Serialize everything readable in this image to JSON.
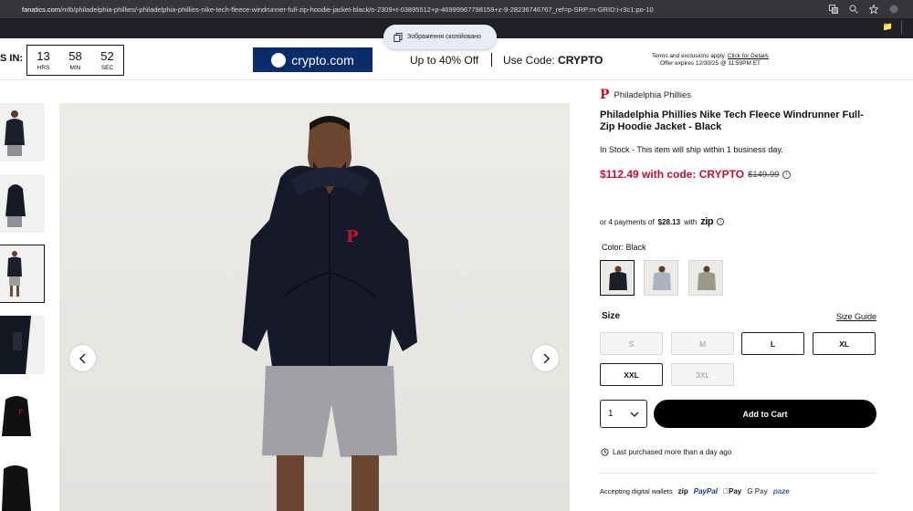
{
  "browser": {
    "url_host": "fanatics.com",
    "url_path": "/mlb/philadelphia-phillies/-philadelphia-phillies-nike-tech-fleece-windrunner-full-zip-hoodie-jacket-black/o-2309+t-03895512+p-46999967798159+z-9-28236746767_ref=p-SRP:m-GRID:i-r3c1:po-10",
    "icons": [
      "translate-icon",
      "zoom-icon",
      "star-icon",
      "profile-icon"
    ]
  },
  "promo": {
    "ends_label": "S IN:",
    "countdown": [
      {
        "value": "13",
        "label": "HRS"
      },
      {
        "value": "58",
        "label": "MIN"
      },
      {
        "value": "52",
        "label": "SEC"
      }
    ],
    "partner_name": "crypto.com",
    "offer": "Up to 40% Off",
    "code_prefix": "Use Code:",
    "code": "CRYPTO",
    "terms_line1": "Terms and exclusions apply.",
    "terms_link": "Click for Details",
    "terms_line2": "Offer expires 12/30/25 @ 11:59PM ET"
  },
  "toast": {
    "text": "Зображення скопійовано"
  },
  "gallery": {
    "prev_icon": "chevron-left-icon",
    "next_icon": "chevron-right-icon"
  },
  "product": {
    "team": "Philadelphia Phillies",
    "title": "Philadelphia Phillies Nike Tech Fleece Windrunner Full-Zip Hoodie Jacket - Black",
    "stock": "In Stock - This item will ship within 1 business day.",
    "price": "$112.49 with code: CRYPTO",
    "original_price": "$149.99",
    "installments_prefix": "or 4 payments of",
    "installments_amount": "$28.13",
    "installments_with": "with",
    "installments_provider": "zip",
    "color_label": "Color:",
    "color_value": "Black",
    "size_label": "Size",
    "size_guide": "Size Guide",
    "sizes": [
      {
        "label": "S",
        "available": false
      },
      {
        "label": "M",
        "available": false
      },
      {
        "label": "L",
        "available": true
      },
      {
        "label": "XL",
        "available": true
      },
      {
        "label": "XXL",
        "available": true
      },
      {
        "label": "3XL",
        "available": false
      }
    ],
    "quantity": "1",
    "add_to_cart": "Add to Cart",
    "last_purchased": "Last purchased more than a day ago",
    "wallets_label": "Accepting digital wallets",
    "wallets": [
      "zip",
      "PayPal",
      "Pay",
      "G Pay",
      "paze"
    ]
  },
  "colors": {
    "accent_red": "#c8102e",
    "crypto_blue": "#0b2c6b",
    "button_black": "#000000"
  }
}
